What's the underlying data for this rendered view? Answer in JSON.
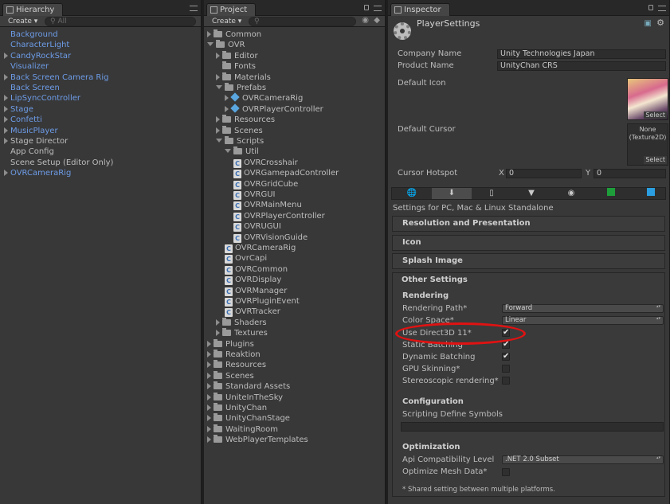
{
  "hierarchy": {
    "tab_label": "Hierarchy",
    "create_label": "Create ▾",
    "search_placeholder": "All",
    "items": [
      {
        "label": "Background",
        "color": "blue",
        "foldout": false
      },
      {
        "label": "CharacterLight",
        "color": "blue",
        "foldout": false
      },
      {
        "label": "CandyRockStar",
        "color": "blue",
        "foldout": true
      },
      {
        "label": "Visualizer",
        "color": "blue",
        "foldout": false
      },
      {
        "label": "Back Screen Camera Rig",
        "color": "blue",
        "foldout": true
      },
      {
        "label": "Back Screen",
        "color": "blue",
        "foldout": false
      },
      {
        "label": "LipSyncController",
        "color": "blue",
        "foldout": true
      },
      {
        "label": "Stage",
        "color": "blue",
        "foldout": true
      },
      {
        "label": "Confetti",
        "color": "blue",
        "foldout": true
      },
      {
        "label": "MusicPlayer",
        "color": "blue",
        "foldout": true
      },
      {
        "label": "Stage Director",
        "color": "grey",
        "foldout": true
      },
      {
        "label": "App Config",
        "color": "grey",
        "foldout": false
      },
      {
        "label": "Scene Setup (Editor Only)",
        "color": "grey",
        "foldout": false
      },
      {
        "label": "OVRCameraRig",
        "color": "blue",
        "foldout": true
      }
    ]
  },
  "project": {
    "tab_label": "Project",
    "create_label": "Create ▾",
    "items": [
      {
        "label": "Common",
        "depth": 0,
        "type": "folder",
        "state": "closed"
      },
      {
        "label": "OVR",
        "depth": 0,
        "type": "folder",
        "state": "open"
      },
      {
        "label": "Editor",
        "depth": 1,
        "type": "folder",
        "state": "closed"
      },
      {
        "label": "Fonts",
        "depth": 1,
        "type": "folder",
        "state": "none"
      },
      {
        "label": "Materials",
        "depth": 1,
        "type": "folder",
        "state": "closed"
      },
      {
        "label": "Prefabs",
        "depth": 1,
        "type": "folder",
        "state": "open"
      },
      {
        "label": "OVRCameraRig",
        "depth": 2,
        "type": "prefab",
        "state": "closed"
      },
      {
        "label": "OVRPlayerController",
        "depth": 2,
        "type": "prefab",
        "state": "closed"
      },
      {
        "label": "Resources",
        "depth": 1,
        "type": "folder",
        "state": "closed"
      },
      {
        "label": "Scenes",
        "depth": 1,
        "type": "folder",
        "state": "closed"
      },
      {
        "label": "Scripts",
        "depth": 1,
        "type": "folder",
        "state": "open"
      },
      {
        "label": "Util",
        "depth": 2,
        "type": "folder",
        "state": "open"
      },
      {
        "label": "OVRCrosshair",
        "depth": 3,
        "type": "script",
        "state": "none"
      },
      {
        "label": "OVRGamepadController",
        "depth": 3,
        "type": "script",
        "state": "none"
      },
      {
        "label": "OVRGridCube",
        "depth": 3,
        "type": "script",
        "state": "none"
      },
      {
        "label": "OVRGUI",
        "depth": 3,
        "type": "script",
        "state": "none"
      },
      {
        "label": "OVRMainMenu",
        "depth": 3,
        "type": "script",
        "state": "none"
      },
      {
        "label": "OVRPlayerController",
        "depth": 3,
        "type": "script",
        "state": "none"
      },
      {
        "label": "OVRUGUI",
        "depth": 3,
        "type": "script",
        "state": "none"
      },
      {
        "label": "OVRVisionGuide",
        "depth": 3,
        "type": "script",
        "state": "none"
      },
      {
        "label": "OVRCameraRig",
        "depth": 2,
        "type": "script",
        "state": "none"
      },
      {
        "label": "OvrCapi",
        "depth": 2,
        "type": "script",
        "state": "none"
      },
      {
        "label": "OVRCommon",
        "depth": 2,
        "type": "script",
        "state": "none"
      },
      {
        "label": "OVRDisplay",
        "depth": 2,
        "type": "script",
        "state": "none"
      },
      {
        "label": "OVRManager",
        "depth": 2,
        "type": "script",
        "state": "none"
      },
      {
        "label": "OVRPluginEvent",
        "depth": 2,
        "type": "script",
        "state": "none"
      },
      {
        "label": "OVRTracker",
        "depth": 2,
        "type": "script",
        "state": "none"
      },
      {
        "label": "Shaders",
        "depth": 1,
        "type": "folder",
        "state": "closed"
      },
      {
        "label": "Textures",
        "depth": 1,
        "type": "folder",
        "state": "closed"
      },
      {
        "label": "Plugins",
        "depth": 0,
        "type": "folder",
        "state": "closed"
      },
      {
        "label": "Reaktion",
        "depth": 0,
        "type": "folder",
        "state": "closed"
      },
      {
        "label": "Resources",
        "depth": 0,
        "type": "folder",
        "state": "closed"
      },
      {
        "label": "Scenes",
        "depth": 0,
        "type": "folder",
        "state": "closed"
      },
      {
        "label": "Standard Assets",
        "depth": 0,
        "type": "folder",
        "state": "closed"
      },
      {
        "label": "UniteInTheSky",
        "depth": 0,
        "type": "folder",
        "state": "closed"
      },
      {
        "label": "UnityChan",
        "depth": 0,
        "type": "folder",
        "state": "closed"
      },
      {
        "label": "UnityChanStage",
        "depth": 0,
        "type": "folder",
        "state": "closed"
      },
      {
        "label": "WaitingRoom",
        "depth": 0,
        "type": "folder",
        "state": "closed"
      },
      {
        "label": "WebPlayerTemplates",
        "depth": 0,
        "type": "folder",
        "state": "closed"
      }
    ]
  },
  "inspector": {
    "tab_label": "Inspector",
    "title": "PlayerSettings",
    "company_name_label": "Company Name",
    "company_name_value": "Unity Technologies Japan",
    "product_name_label": "Product Name",
    "product_name_value": "UnityChan CRS",
    "default_icon_label": "Default Icon",
    "default_icon_select": "Select",
    "default_cursor_label": "Default Cursor",
    "default_cursor_value_line1": "None",
    "default_cursor_value_line2": "(Texture2D)",
    "default_cursor_select": "Select",
    "cursor_hotspot_label": "Cursor Hotspot",
    "hotspot_x_label": "X",
    "hotspot_x_value": "0",
    "hotspot_y_label": "Y",
    "hotspot_y_value": "0",
    "platform_caption": "Settings for PC, Mac & Linux Standalone",
    "sections": {
      "resolution": "Resolution and Presentation",
      "icon": "Icon",
      "splash": "Splash Image",
      "other": "Other Settings"
    },
    "rendering": {
      "header": "Rendering",
      "rendering_path_label": "Rendering Path*",
      "rendering_path_value": "Forward",
      "color_space_label": "Color Space*",
      "color_space_value": "Linear",
      "use_d3d11_label": "Use Direct3D 11*",
      "use_d3d11_checked": true,
      "static_batching_label": "Static Batching",
      "static_batching_checked": true,
      "dynamic_batching_label": "Dynamic Batching",
      "dynamic_batching_checked": true,
      "gpu_skinning_label": "GPU Skinning*",
      "gpu_skinning_checked": false,
      "stereo_label": "Stereoscopic rendering*",
      "stereo_checked": false
    },
    "configuration": {
      "header": "Configuration",
      "define_symbols_label": "Scripting Define Symbols",
      "define_symbols_value": ""
    },
    "optimization": {
      "header": "Optimization",
      "api_level_label": "Api Compatibility Level",
      "api_level_value": ".NET 2.0 Subset",
      "optimize_mesh_label": "Optimize Mesh Data*",
      "optimize_mesh_checked": false
    },
    "footnote": "* Shared setting between multiple platforms."
  },
  "colors": {
    "link_blue": "#6d9ce8",
    "highlight_red": "#e01212",
    "panel_bg": "#383838"
  }
}
